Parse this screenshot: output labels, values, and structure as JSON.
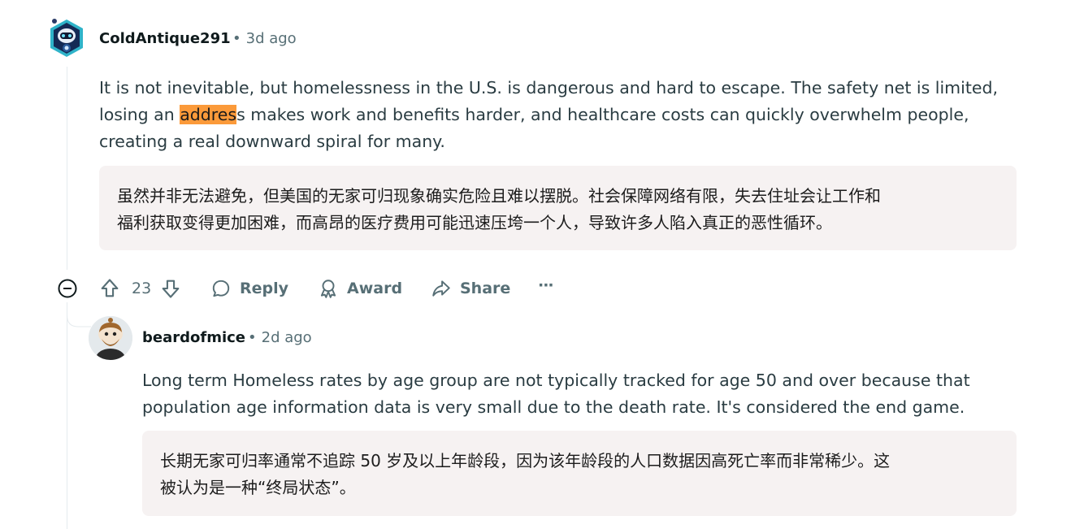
{
  "comment1": {
    "username": "ColdAntique291",
    "meta_sep": "•",
    "time": "3d ago",
    "body_line1": "It is not inevitable, but homelessness in the U.S. is dangerous and hard to escape. The safety net is limited,",
    "body_line2_before": "losing an ",
    "body_line2_highlight": "addres",
    "body_line2_after": "s makes work and benefits harder, and healthcare costs can quickly overwhelm people,",
    "body_line3": "creating a real downward spiral for many.",
    "translation_line1": "虽然并非无法避免，但美国的无家可归现象确实危险且难以摆脱。社会保障网络有限，失去住址会让工作和",
    "translation_line2": "福利获取变得更加困难，而高昂的医疗费用可能迅速压垮一个人，导致许多人陷入真正的恶性循环。",
    "actions": {
      "vote_count": "23",
      "reply": "Reply",
      "award": "Award",
      "share": "Share",
      "more": "···"
    }
  },
  "comment2": {
    "username": "beardofmice",
    "meta_sep": "•",
    "time": "2d ago",
    "body_line1": "Long term Homeless rates by age group are not typically tracked for age 50 and over because that",
    "body_line2": "population age information data is very small due to the death rate. It's considered the end game.",
    "translation_line1": "长期无家可归率通常不追踪 50 岁及以上年龄段，因为该年龄段的人口数据因高死亡率而非常稀少。这",
    "translation_line2": "被认为是一种“终局状态”。"
  },
  "colors": {
    "highlight": "#fb9a3a",
    "translation_bg": "#f6f2f2",
    "muted": "#576f76"
  },
  "icons": [
    "avatar-robot",
    "avatar-snoo",
    "upvote-icon",
    "downvote-icon",
    "reply-icon",
    "award-icon",
    "share-icon",
    "more-icon",
    "collapse-icon"
  ]
}
